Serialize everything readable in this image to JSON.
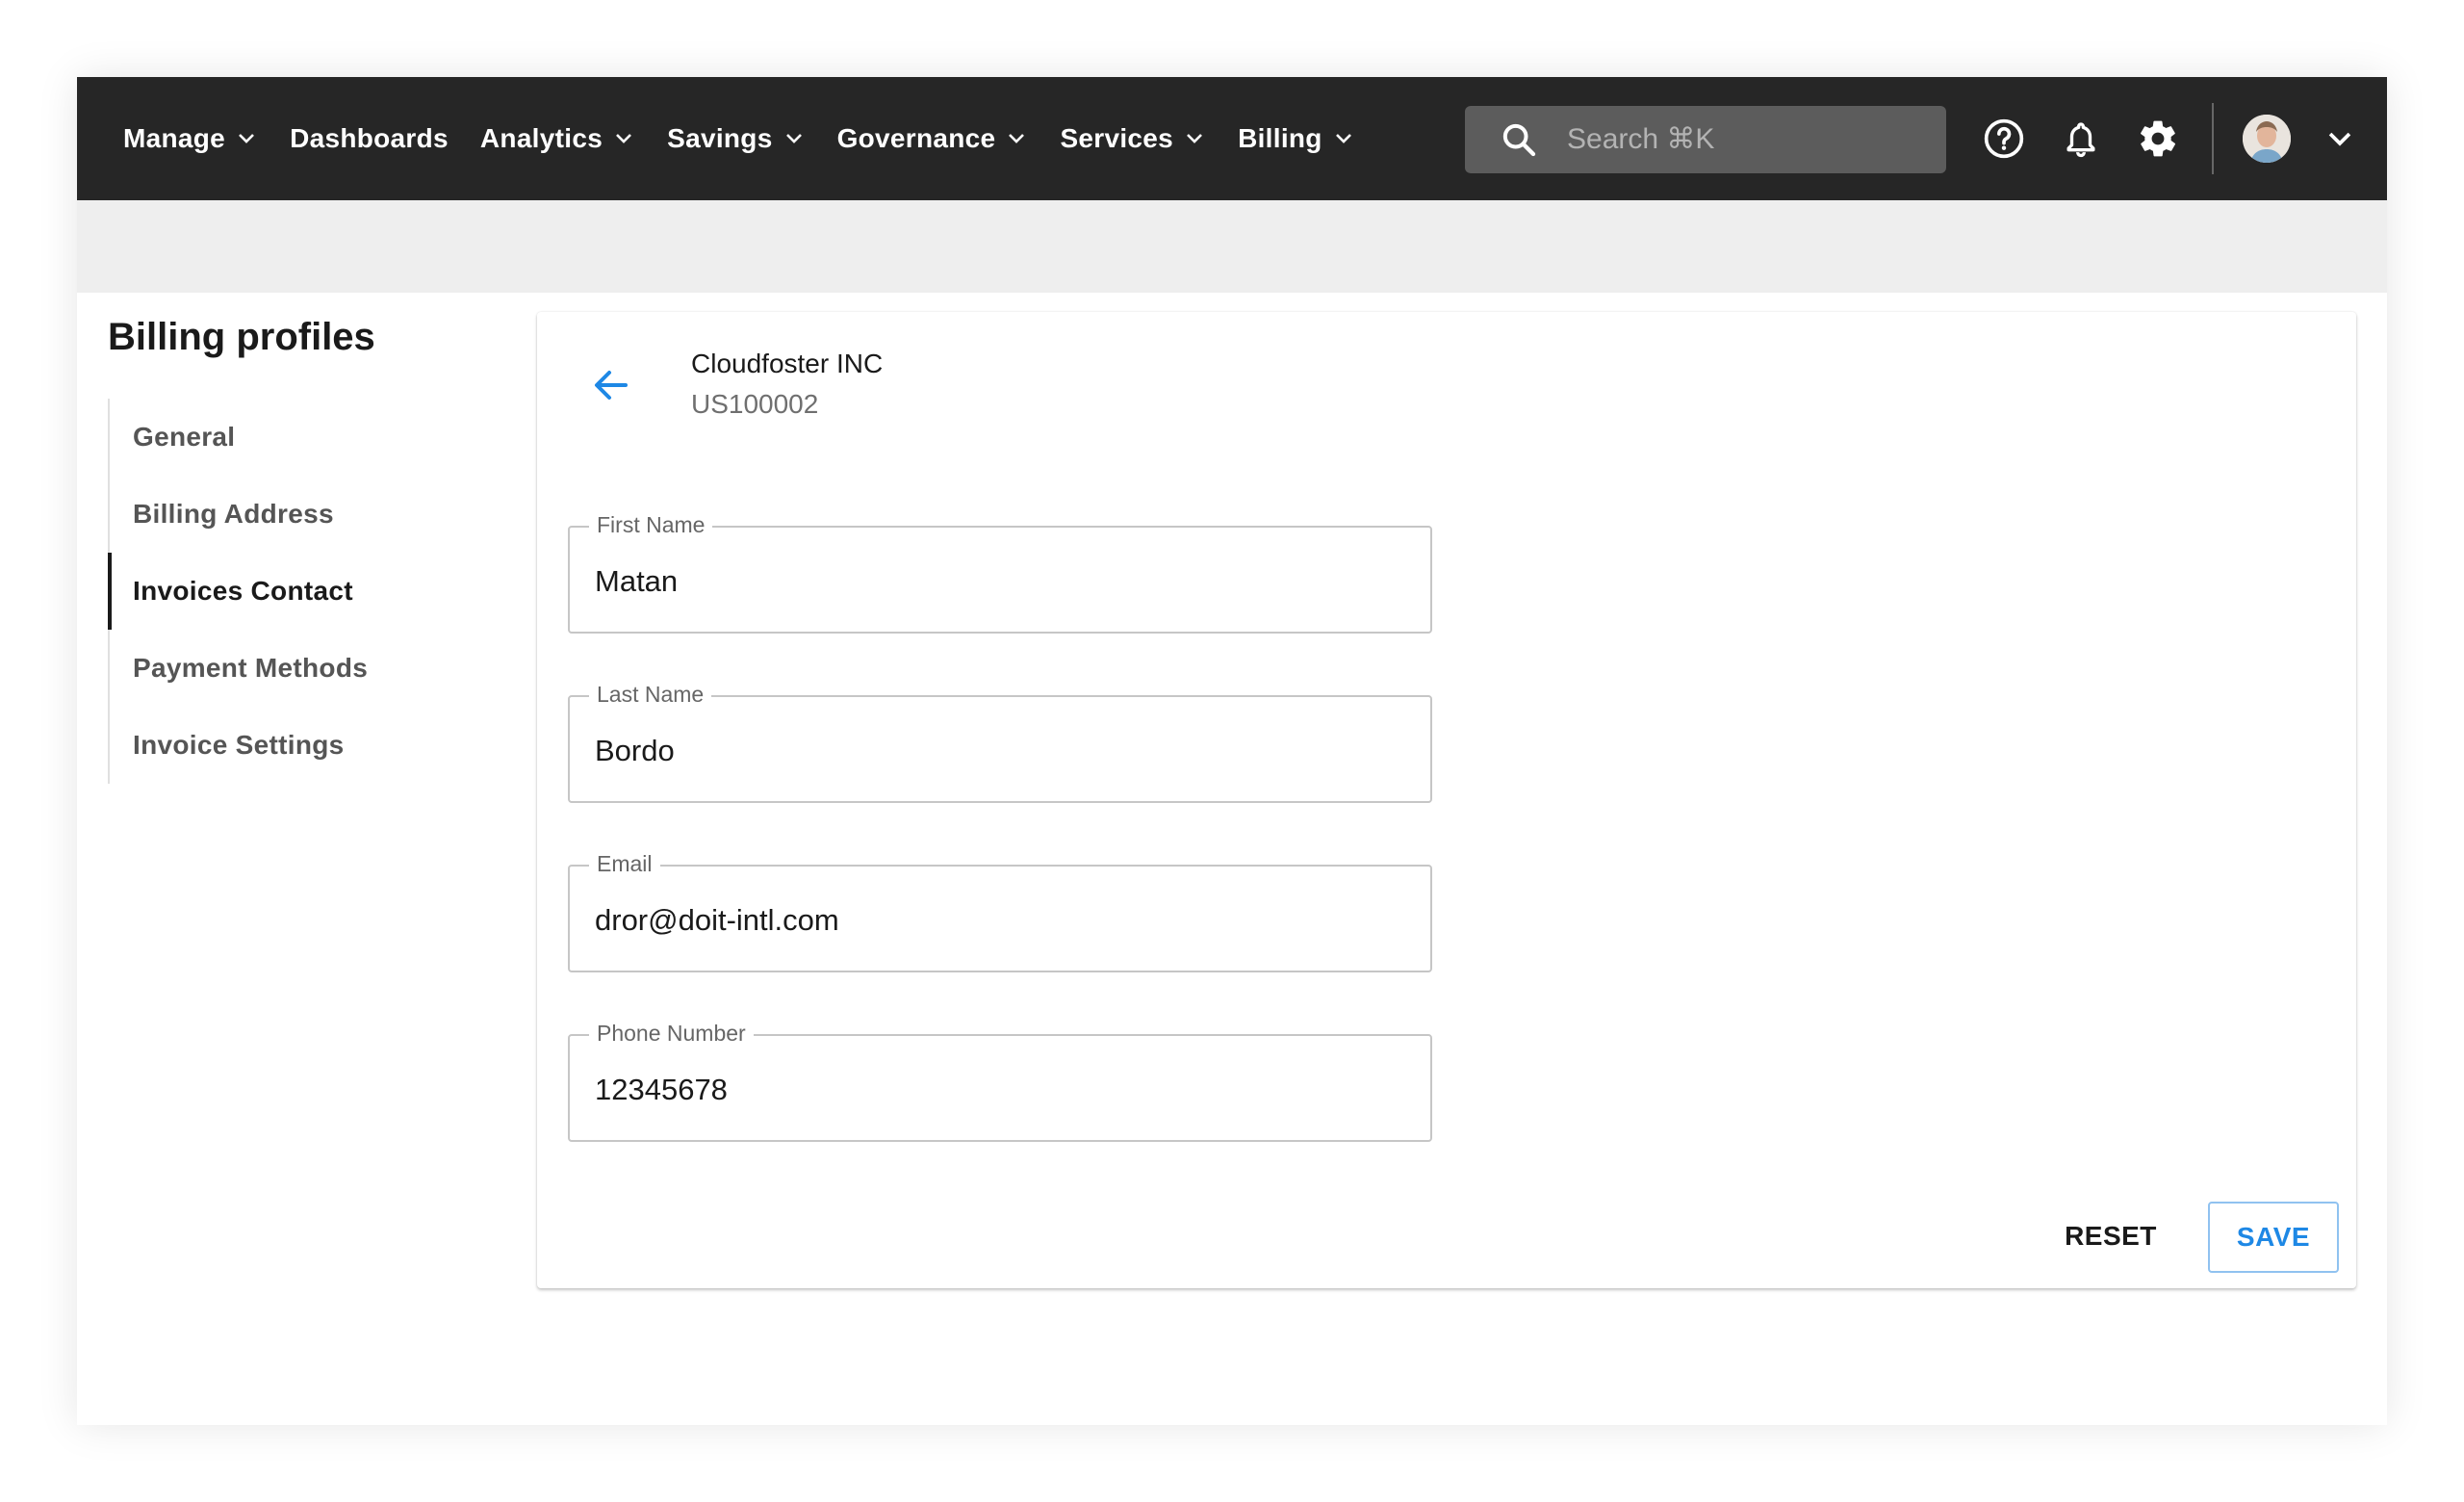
{
  "colors": {
    "topbar": "#262626",
    "accent": "#1e88e5",
    "band": "#eeeeee"
  },
  "nav": {
    "items": [
      {
        "label": "Manage",
        "has_dropdown": true
      },
      {
        "label": "Dashboards",
        "has_dropdown": false
      },
      {
        "label": "Analytics",
        "has_dropdown": true
      },
      {
        "label": "Savings",
        "has_dropdown": true
      },
      {
        "label": "Governance",
        "has_dropdown": true
      },
      {
        "label": "Services",
        "has_dropdown": true
      },
      {
        "label": "Billing",
        "has_dropdown": true
      }
    ],
    "search_placeholder": "Search ⌘K",
    "icons": [
      "help-icon",
      "bell-icon",
      "gear-icon",
      "avatar",
      "chevron-down-icon"
    ]
  },
  "sidebar": {
    "title": "Billing profiles",
    "items": [
      {
        "label": "General",
        "active": false
      },
      {
        "label": "Billing Address",
        "active": false
      },
      {
        "label": "Invoices Contact",
        "active": true
      },
      {
        "label": "Payment Methods",
        "active": false
      },
      {
        "label": "Invoice Settings",
        "active": false
      }
    ]
  },
  "card": {
    "company_name": "Cloudfoster INC",
    "company_id": "US100002",
    "fields": {
      "first_name": {
        "label": "First Name",
        "value": "Matan"
      },
      "last_name": {
        "label": "Last Name",
        "value": "Bordo"
      },
      "email": {
        "label": "Email",
        "value": "dror@doit-intl.com"
      },
      "phone": {
        "label": "Phone Number",
        "value": "12345678"
      }
    },
    "reset_label": "RESET",
    "save_label": "SAVE"
  }
}
